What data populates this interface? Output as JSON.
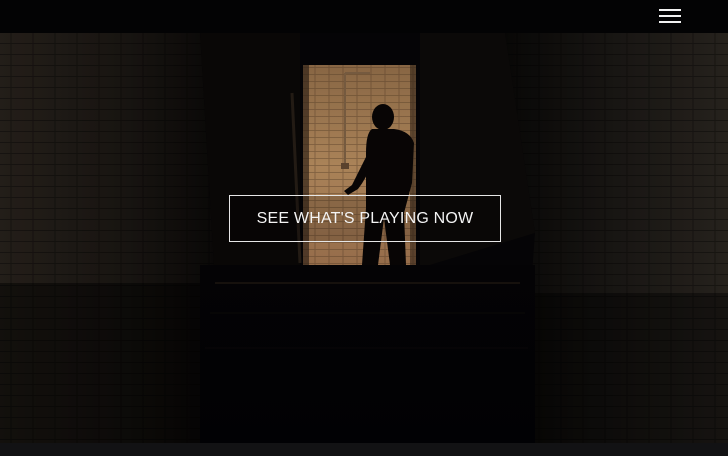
{
  "header": {
    "menu_icon": "hamburger-menu-icon",
    "bar_color": "#030304"
  },
  "hero": {
    "cta_label": "SEE WHAT'S PLAYING NOW",
    "scene": "dark-stairwell-doorway-silhouette"
  }
}
